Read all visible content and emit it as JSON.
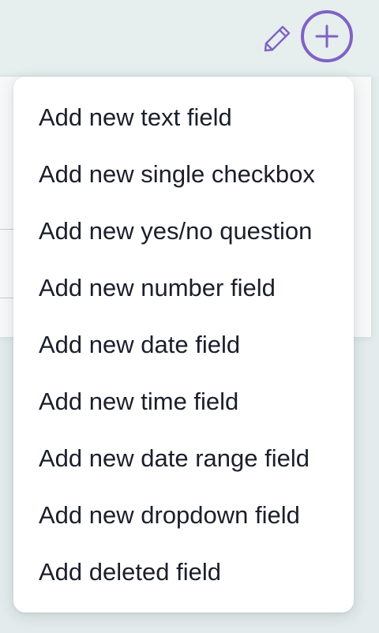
{
  "toolbar": {
    "edit_icon": "pencil-icon",
    "add_icon": "plus-icon",
    "accent_color": "#7f63c4"
  },
  "menu": {
    "items": [
      {
        "label": "Add new text field"
      },
      {
        "label": "Add new single checkbox"
      },
      {
        "label": "Add new yes/no question"
      },
      {
        "label": "Add new number field"
      },
      {
        "label": "Add new date field"
      },
      {
        "label": "Add new time field"
      },
      {
        "label": "Add new date range field"
      },
      {
        "label": "Add new dropdown field"
      },
      {
        "label": "Add deleted field"
      }
    ]
  }
}
